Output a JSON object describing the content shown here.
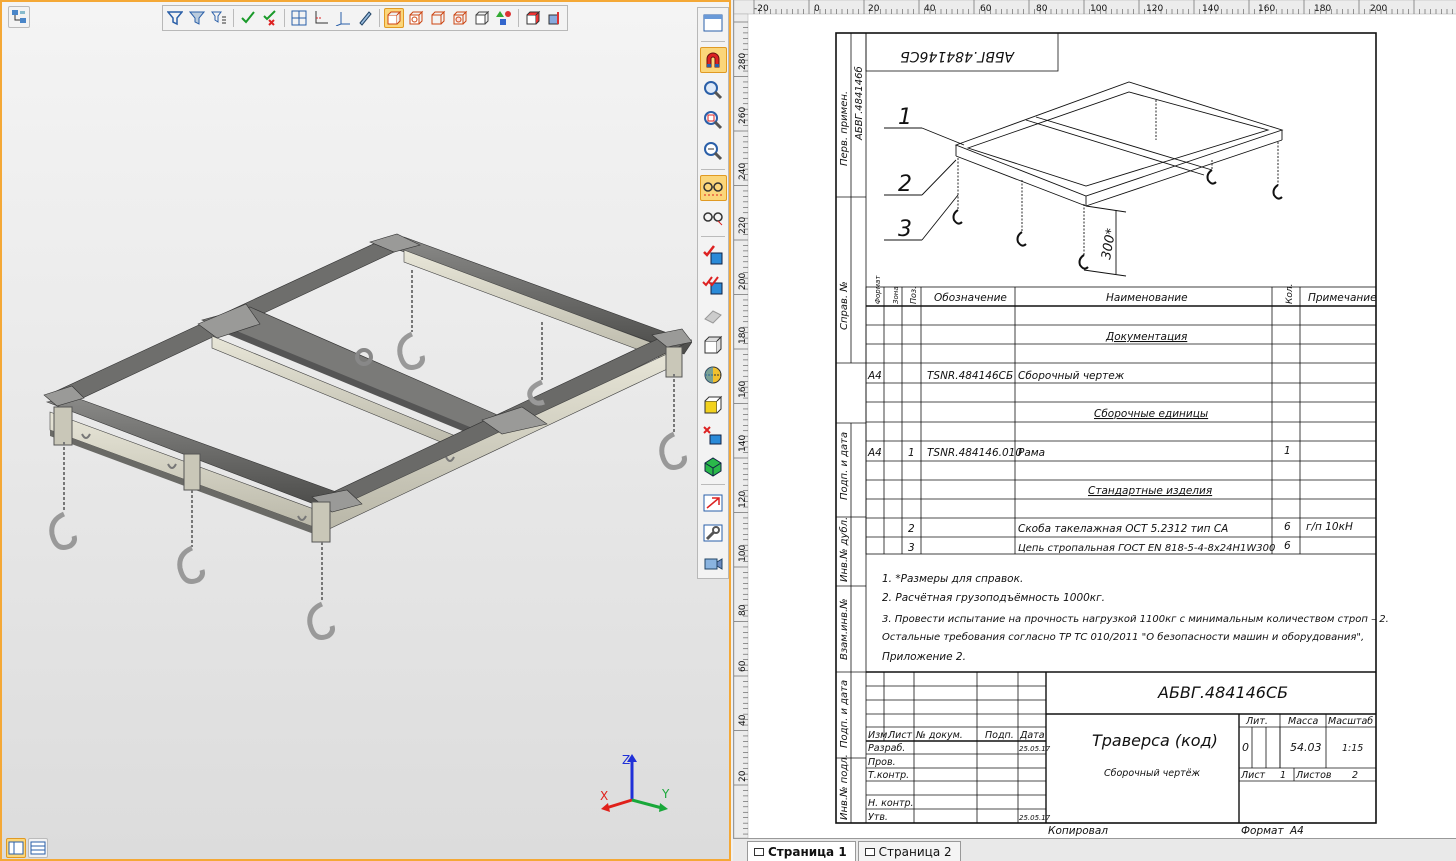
{
  "colors": {
    "accent": "#f4a836",
    "active_btn": "#fbd67a",
    "axis_x": "#e0201a",
    "axis_y": "#19a83a",
    "axis_z": "#2030d8"
  },
  "viewport": {
    "axes": {
      "x": "X",
      "y": "Y",
      "z": "Z"
    }
  },
  "top_toolbar": {
    "icons": [
      "filter-icon",
      "filter-icon",
      "filter-list-icon",
      "check-icon",
      "uncheck-icon",
      "grid-icon",
      "axis-icon",
      "axis-3d-icon",
      "pen-icon",
      "cube-icon",
      "cube-shaded-icon",
      "cube-wire-icon",
      "cube-hidden-icon",
      "cube-outline-icon",
      "shapes-icon",
      "cube-red-icon",
      "cube-blue-icon"
    ]
  },
  "right_toolbar": {
    "icons": [
      "window-icon",
      "magnet-icon",
      "zoom-icon",
      "zoom-window-icon",
      "zoom-fit-icon",
      "glasses-icon",
      "glasses-icon",
      "check-cube-icon",
      "check-cube-multi-icon",
      "move-icon",
      "cube-icon",
      "sphere-icon",
      "cube-yellow-icon",
      "cube-cut-icon",
      "cube-green-icon",
      "arrow-icon",
      "wrench-icon",
      "camera-icon"
    ]
  },
  "ruler": {
    "h": [
      "-20",
      "0",
      "20",
      "40",
      "60",
      "80",
      "100",
      "120",
      "140",
      "160",
      "180",
      "200"
    ],
    "v": [
      "280",
      "260",
      "240",
      "220",
      "200",
      "180",
      "160",
      "140",
      "120",
      "100",
      "80",
      "60",
      "40",
      "20"
    ]
  },
  "drawing": {
    "designation_mirrored": "АБВГ.484146СБ",
    "side": {
      "perv_primen": "Перв. примен.",
      "perv_primen_val": "АБВГ.484146б",
      "sprav_no": "Справ. №",
      "podp_data": "Подп. и дата",
      "inv_dubl": "Инв.№ дубл.",
      "vzam_inv": "Взам.инв.№",
      "podp_data2": "Подп. и дата",
      "inv_podl": "Инв.№ подл."
    },
    "callouts": [
      "1",
      "2",
      "3"
    ],
    "dimension": "300*",
    "spec_headers": {
      "format": "Формат",
      "zone": "Зона",
      "pos": "Поз.",
      "designation": "Обозначение",
      "name": "Наименование",
      "qty": "Кол.",
      "note": "Примечание"
    },
    "sections": {
      "docs": "Документация",
      "assembly": "Сборочные единицы",
      "standard": "Стандартные изделия"
    },
    "rows": [
      {
        "format": "A4",
        "pos": "",
        "designation": "TSNR.484146СБ",
        "name": "Сборочный чертеж",
        "qty": "",
        "note": ""
      },
      {
        "format": "A4",
        "pos": "1",
        "designation": "TSNR.484146.010",
        "name": "Рама",
        "qty": "1",
        "note": ""
      },
      {
        "format": "",
        "pos": "2",
        "designation": "",
        "name": "Скоба такелажная ОСТ 5.2312 тип СА",
        "qty": "6",
        "note": "г/п 10кН"
      },
      {
        "format": "",
        "pos": "3",
        "designation": "",
        "name": "Цепь стропальная ГОСТ EN 818-5-4-8x24H1W300",
        "qty": "6",
        "note": ""
      }
    ],
    "notes": [
      "1. *Размеры для справок.",
      "2. Расчётная грузоподъёмность 1000кг.",
      "3. Провести испытание на прочность нагрузкой 1100кг с минимальным количеством строп – 2.",
      "Остальные требования согласно ТР ТС 010/2011 \"О безопасности машин и оборудования\",",
      "Приложение 2."
    ],
    "title_block": {
      "designation": "АБВГ.484146СБ",
      "name": "Траверса (код)",
      "doc_type": "Сборочный чертёж",
      "izm": "Изм.",
      "list": "Лист",
      "doc_no": "№ докум.",
      "podp": "Подп.",
      "data": "Дата",
      "razrab": "Разраб.",
      "prov": "Пров.",
      "tkontr": "Т.контр.",
      "nkontr": "Н. контр.",
      "utv": "Утв.",
      "date1": "25.05.17",
      "date2": "25.05.17",
      "lit_label": "Лит.",
      "mass_label": "Масса",
      "scale_label": "Масштаб",
      "lit": "0",
      "mass": "54.03",
      "scale": "1:15",
      "sheet_label": "Лист",
      "sheet": "1",
      "sheets_label": "Листов",
      "sheets": "2"
    },
    "footer": {
      "copied": "Копировал",
      "format_label": "Формат",
      "format": "А4"
    }
  },
  "tabs": [
    {
      "label": "Страница 1",
      "active": true
    },
    {
      "label": "Страница 2",
      "active": false
    }
  ],
  "bottom_left_icons": [
    "layout-split-icon",
    "layout-rows-icon"
  ]
}
